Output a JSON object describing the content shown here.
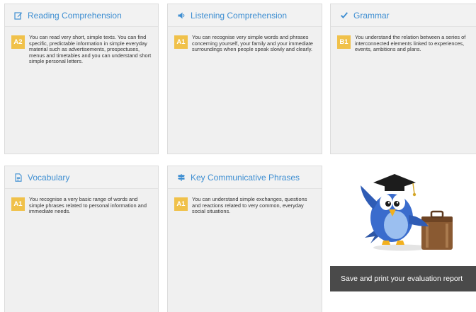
{
  "cards": [
    {
      "title": "Reading Comprehension",
      "icon": "edit-icon",
      "level": "A2",
      "description": "You can read very short, simple texts. You can find specific, predictable information in simple everyday material such as advertisements, prospectuses, menus and timetables and you can understand short simple personal letters."
    },
    {
      "title": "Listening Comprehension",
      "icon": "volume-icon",
      "level": "A1",
      "description": "You can recognise very simple words and phrases concerning yourself, your family and your immediate surroundings when people speak slowly and clearly."
    },
    {
      "title": "Grammar",
      "icon": "check-icon",
      "level": "B1",
      "description": "You understand the relation between a series of interconnected elements linked to experiences, events, ambitions and plans."
    },
    {
      "title": "Vocabulary",
      "icon": "document-icon",
      "level": "A1",
      "description": "You recognise a very basic range of words and simple phrases related to personal information and immediate needs."
    },
    {
      "title": "Key Communicative Phrases",
      "icon": "signpost-icon",
      "level": "A1",
      "description": "You can understand simple exchanges, questions and reactions related to very common, everyday social situations."
    }
  ],
  "save_button_label": "Save and print your evaluation report",
  "colors": {
    "title": "#3f8fd2",
    "badge": "#f0c14a",
    "card_background": "#f0f0f0",
    "button_background": "#4a4a4a"
  }
}
